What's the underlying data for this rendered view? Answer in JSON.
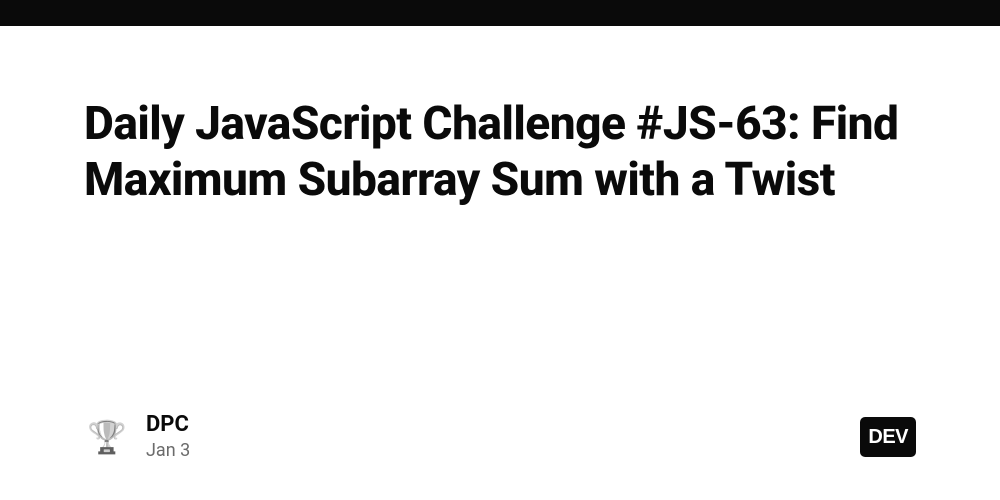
{
  "article": {
    "title": "Daily JavaScript Challenge #JS-63: Find Maximum Subarray Sum with a Twist"
  },
  "author": {
    "avatar_emoji": "🏆",
    "name": "DPC",
    "date": "Jan 3"
  },
  "brand": {
    "logo_text": "DEV"
  }
}
